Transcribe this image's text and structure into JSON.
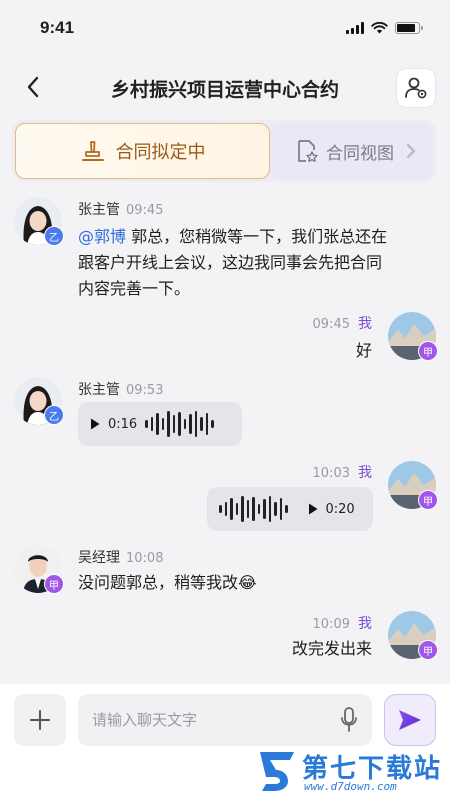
{
  "status_bar": {
    "time": "9:41",
    "battery_level": 0.85
  },
  "header": {
    "title": "乡村振兴项目运营中心合约"
  },
  "tabs": [
    {
      "label": "合同拟定中",
      "icon": "signing-pen-icon",
      "active": true
    },
    {
      "label": "合同视图",
      "icon": "document-star-icon",
      "active": false
    }
  ],
  "messages": [
    {
      "side": "left",
      "sender": "张主管",
      "time": "09:45",
      "badge": "乙",
      "type": "text",
      "mention": "@郭博",
      "text_lines": [
        "郭总，您稍微等一下，我们张总还在",
        "跟客户开线上会议，这边我同事会先把合同",
        "内容完善一下。"
      ]
    },
    {
      "side": "right",
      "sender": "我",
      "time": "09:45",
      "badge": "甲",
      "type": "text",
      "text": "好"
    },
    {
      "side": "left",
      "sender": "张主管",
      "time": "09:53",
      "badge": "乙",
      "type": "voice",
      "duration": "0:16"
    },
    {
      "side": "right",
      "sender": "我",
      "time": "10:03",
      "badge": "甲",
      "type": "voice",
      "duration": "0:20"
    },
    {
      "side": "left",
      "sender": "吴经理",
      "time": "10:08",
      "badge": "甲",
      "type": "text",
      "text": "没问题郭总，稍等我改😂"
    },
    {
      "side": "right",
      "sender": "我",
      "time": "10:09",
      "badge": "甲",
      "type": "text",
      "text": "改完发出来"
    }
  ],
  "input": {
    "placeholder": "请输入聊天文字"
  },
  "watermark": {
    "title": "第七下载站",
    "url": "www.d7down.com"
  },
  "colors": {
    "accent": "#7b4fd6",
    "mention": "#2f6bdc",
    "active_tab_text": "#9a5a16",
    "badge_yi": "#4a7cf0",
    "badge_jia": "#a256e8"
  }
}
